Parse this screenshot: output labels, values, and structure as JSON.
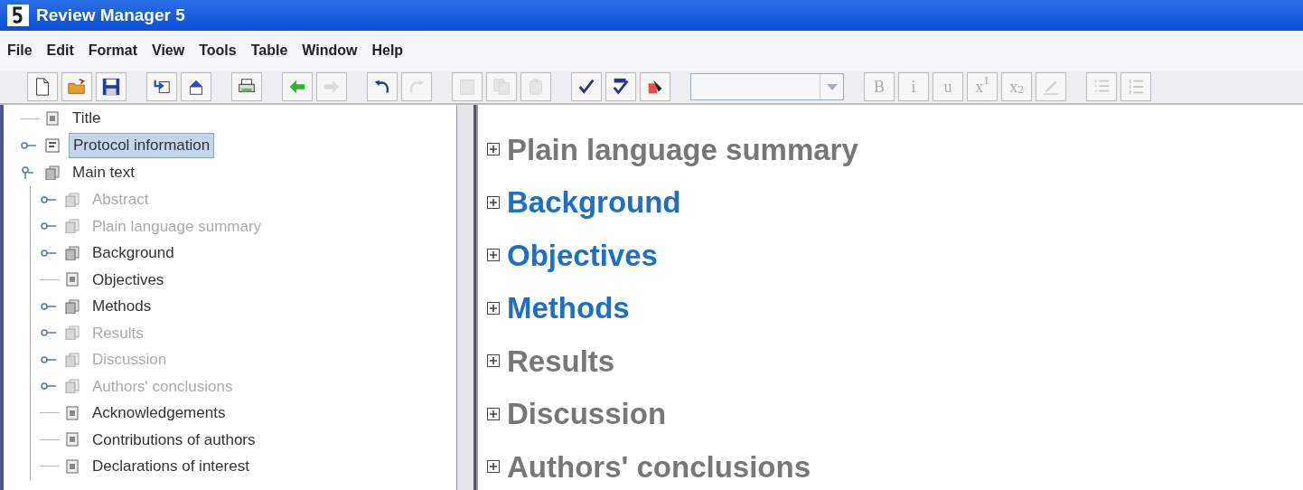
{
  "window": {
    "title": "Review Manager 5"
  },
  "menu": [
    "File",
    "Edit",
    "Format",
    "View",
    "Tools",
    "Table",
    "Window",
    "Help"
  ],
  "toolbar": [
    {
      "kind": "new",
      "disabled": false
    },
    {
      "kind": "open",
      "disabled": false
    },
    {
      "kind": "save",
      "disabled": false
    },
    {
      "kind": "sep"
    },
    {
      "kind": "import",
      "disabled": false
    },
    {
      "kind": "export",
      "disabled": false
    },
    {
      "kind": "sep"
    },
    {
      "kind": "print",
      "disabled": false
    },
    {
      "kind": "sep"
    },
    {
      "kind": "back",
      "disabled": false
    },
    {
      "kind": "forward",
      "disabled": true
    },
    {
      "kind": "sep"
    },
    {
      "kind": "undo",
      "disabled": false
    },
    {
      "kind": "redo",
      "disabled": true
    },
    {
      "kind": "sep"
    },
    {
      "kind": "cut",
      "disabled": true
    },
    {
      "kind": "copy",
      "disabled": true
    },
    {
      "kind": "paste",
      "disabled": true
    },
    {
      "kind": "sep"
    },
    {
      "kind": "check",
      "disabled": false
    },
    {
      "kind": "spell",
      "disabled": false
    },
    {
      "kind": "clean",
      "disabled": false
    },
    {
      "kind": "sep"
    },
    {
      "kind": "combo",
      "disabled": true
    },
    {
      "kind": "sep"
    },
    {
      "kind": "text",
      "label": "B",
      "disabled": true
    },
    {
      "kind": "text",
      "label": "i",
      "disabled": true
    },
    {
      "kind": "text",
      "label": "u",
      "disabled": true
    },
    {
      "kind": "text",
      "label": "x$^{1}$",
      "disabled": true
    },
    {
      "kind": "text",
      "label": "x$_{2}$",
      "disabled": true
    },
    {
      "kind": "pen",
      "disabled": true
    },
    {
      "kind": "sep"
    },
    {
      "kind": "bullets",
      "disabled": true
    },
    {
      "kind": "numbers",
      "disabled": true
    }
  ],
  "tree": [
    {
      "label": "Title",
      "kind": "page",
      "selected": false,
      "dimmed": false
    },
    {
      "label": "Protocol information",
      "kind": "form",
      "expanded": false,
      "selected": true,
      "dimmed": false
    },
    {
      "label": "Main text",
      "kind": "folder",
      "expanded": true,
      "selected": false,
      "dimmed": false,
      "children": [
        {
          "label": "Abstract",
          "kind": "folder",
          "expanded": false,
          "selected": false,
          "dimmed": true
        },
        {
          "label": "Plain language summary",
          "kind": "folder",
          "expanded": false,
          "selected": false,
          "dimmed": true
        },
        {
          "label": "Background",
          "kind": "folder",
          "expanded": false,
          "selected": false,
          "dimmed": false
        },
        {
          "label": "Objectives",
          "kind": "page",
          "selected": false,
          "dimmed": false
        },
        {
          "label": "Methods",
          "kind": "folder",
          "expanded": false,
          "selected": false,
          "dimmed": false
        },
        {
          "label": "Results",
          "kind": "folder",
          "expanded": false,
          "selected": false,
          "dimmed": true
        },
        {
          "label": "Discussion",
          "kind": "folder",
          "expanded": false,
          "selected": false,
          "dimmed": true
        },
        {
          "label": "Authors' conclusions",
          "kind": "folder",
          "expanded": false,
          "selected": false,
          "dimmed": true
        },
        {
          "label": "Acknowledgements",
          "kind": "page",
          "selected": false,
          "dimmed": false
        },
        {
          "label": "Contributions of authors",
          "kind": "page",
          "selected": false,
          "dimmed": false
        },
        {
          "label": "Declarations of interest",
          "kind": "page",
          "selected": false,
          "dimmed": false
        }
      ]
    }
  ],
  "sections": [
    {
      "label": "Plain language summary",
      "filled": false
    },
    {
      "label": "Background",
      "filled": true
    },
    {
      "label": "Objectives",
      "filled": true
    },
    {
      "label": "Methods",
      "filled": true
    },
    {
      "label": "Results",
      "filled": false
    },
    {
      "label": "Discussion",
      "filled": false
    },
    {
      "label": "Authors' conclusions",
      "filled": false
    }
  ]
}
